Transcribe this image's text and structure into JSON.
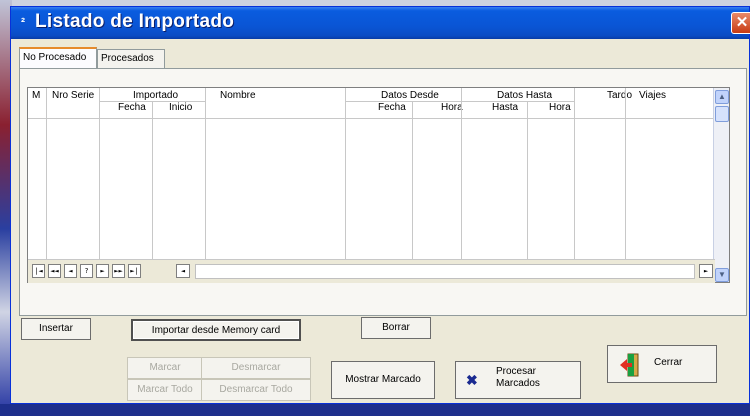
{
  "window": {
    "title": "Listado de Importado",
    "close_glyph": "✕"
  },
  "tabs": [
    {
      "label": "No Procesado",
      "active": true
    },
    {
      "label": "Procesados",
      "active": false
    }
  ],
  "grid": {
    "columns": {
      "m": "M",
      "nro_serie": "Nro Serie",
      "importado": "Importado",
      "importado_fecha": "Fecha",
      "importado_inicio": "Inicio",
      "nombre": "Nombre",
      "datos_desde": "Datos Desde",
      "desde_fecha": "Fecha",
      "desde_hora": "Hora",
      "datos_hasta": "Datos Hasta",
      "hasta_hasta": "Hasta",
      "hasta_hora": "Hora",
      "tardo": "Tardo",
      "viajes": "Viajes"
    },
    "rows": [],
    "nav_buttons": [
      "|◄",
      "◄◄",
      "◄",
      "?",
      "►",
      "►►",
      "►|"
    ]
  },
  "buttons": {
    "insertar": "Insertar",
    "importar": "Importar desde Memory card",
    "borrar": "Borrar",
    "marcar": "Marcar",
    "desmarcar": "Desmarcar",
    "marcar_todo": "Marcar Todo",
    "desmarcar_todo": "Desmarcar Todo",
    "mostrar_marcado": "Mostrar Marcado",
    "procesar_line1": "Procesar",
    "procesar_line2": "Marcados",
    "cerrar": "Cerrar"
  },
  "colors": {
    "titlebar": "#0a55d5",
    "tab_accent": "#e68b2c",
    "close": "#c83a12"
  }
}
